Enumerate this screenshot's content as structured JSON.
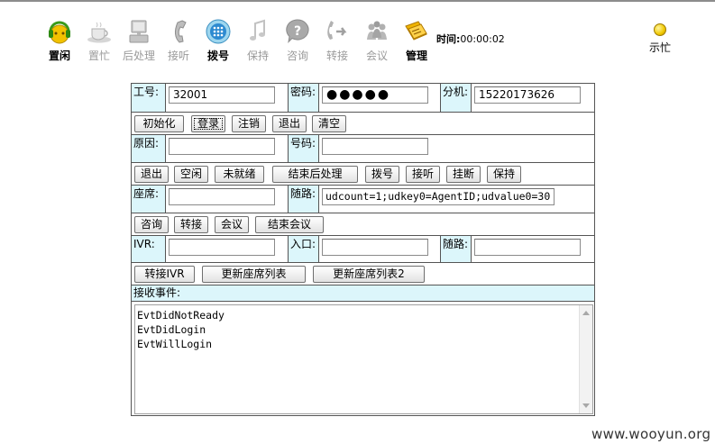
{
  "toolbar": {
    "items": [
      {
        "label": "置闲",
        "icon": "headset-icon",
        "enabled": true
      },
      {
        "label": "置忙",
        "icon": "coffee-cup-icon",
        "enabled": false
      },
      {
        "label": "后处理",
        "icon": "computer-icon",
        "enabled": false
      },
      {
        "label": "接听",
        "icon": "phone-receiver-icon",
        "enabled": false
      },
      {
        "label": "拨号",
        "icon": "dial-pad-icon",
        "enabled": true
      },
      {
        "label": "保持",
        "icon": "music-note-icon",
        "enabled": false
      },
      {
        "label": "咨询",
        "icon": "question-bubble-icon",
        "enabled": false
      },
      {
        "label": "转接",
        "icon": "transfer-arrow-icon",
        "enabled": false
      },
      {
        "label": "会议",
        "icon": "conference-icon",
        "enabled": false
      },
      {
        "label": "管理",
        "icon": "management-icon",
        "enabled": true
      }
    ],
    "timer_label": "时间:",
    "timer_value": "00:00:02",
    "status_label": "示忙",
    "status_color": "#f0c800"
  },
  "form": {
    "row1": {
      "agent_id_label": "工号:",
      "agent_id_value": "32001",
      "password_label": "密码:",
      "password_value": "●●●●●",
      "extension_label": "分机:",
      "extension_value": "15220173626"
    },
    "buttons1": [
      "初始化",
      "登录",
      "注销",
      "退出",
      "清空"
    ],
    "row2": {
      "reason_label": "原因:",
      "reason_value": "",
      "number_label": "号码:",
      "number_value": ""
    },
    "buttons2": [
      "退出",
      "空闲",
      "未就绪",
      "结束后处理",
      "拨号",
      "接听",
      "挂断",
      "保持"
    ],
    "row3": {
      "seat_label": "座席:",
      "seat_value": "",
      "data_label": "随路:",
      "data_value": "udcount=1;udkey0=AgentID;udvalue0=30"
    },
    "buttons3": [
      "咨询",
      "转接",
      "会议",
      "结束会议"
    ],
    "row4": {
      "ivr_label": "IVR:",
      "ivr_value": "",
      "entry_label": "入口:",
      "entry_value": "",
      "data2_label": "随路:",
      "data2_value": ""
    },
    "buttons4": [
      "转接IVR",
      "更新座席列表",
      "更新座席列表2"
    ],
    "events_label": "接收事件:",
    "events": [
      "EvtDidNotReady",
      "EvtDidLogin",
      "EvtWillLogin"
    ]
  },
  "watermark": "www.wooyun.org",
  "colors": {
    "label_bg": "#dcf6fb",
    "border": "#555555"
  }
}
